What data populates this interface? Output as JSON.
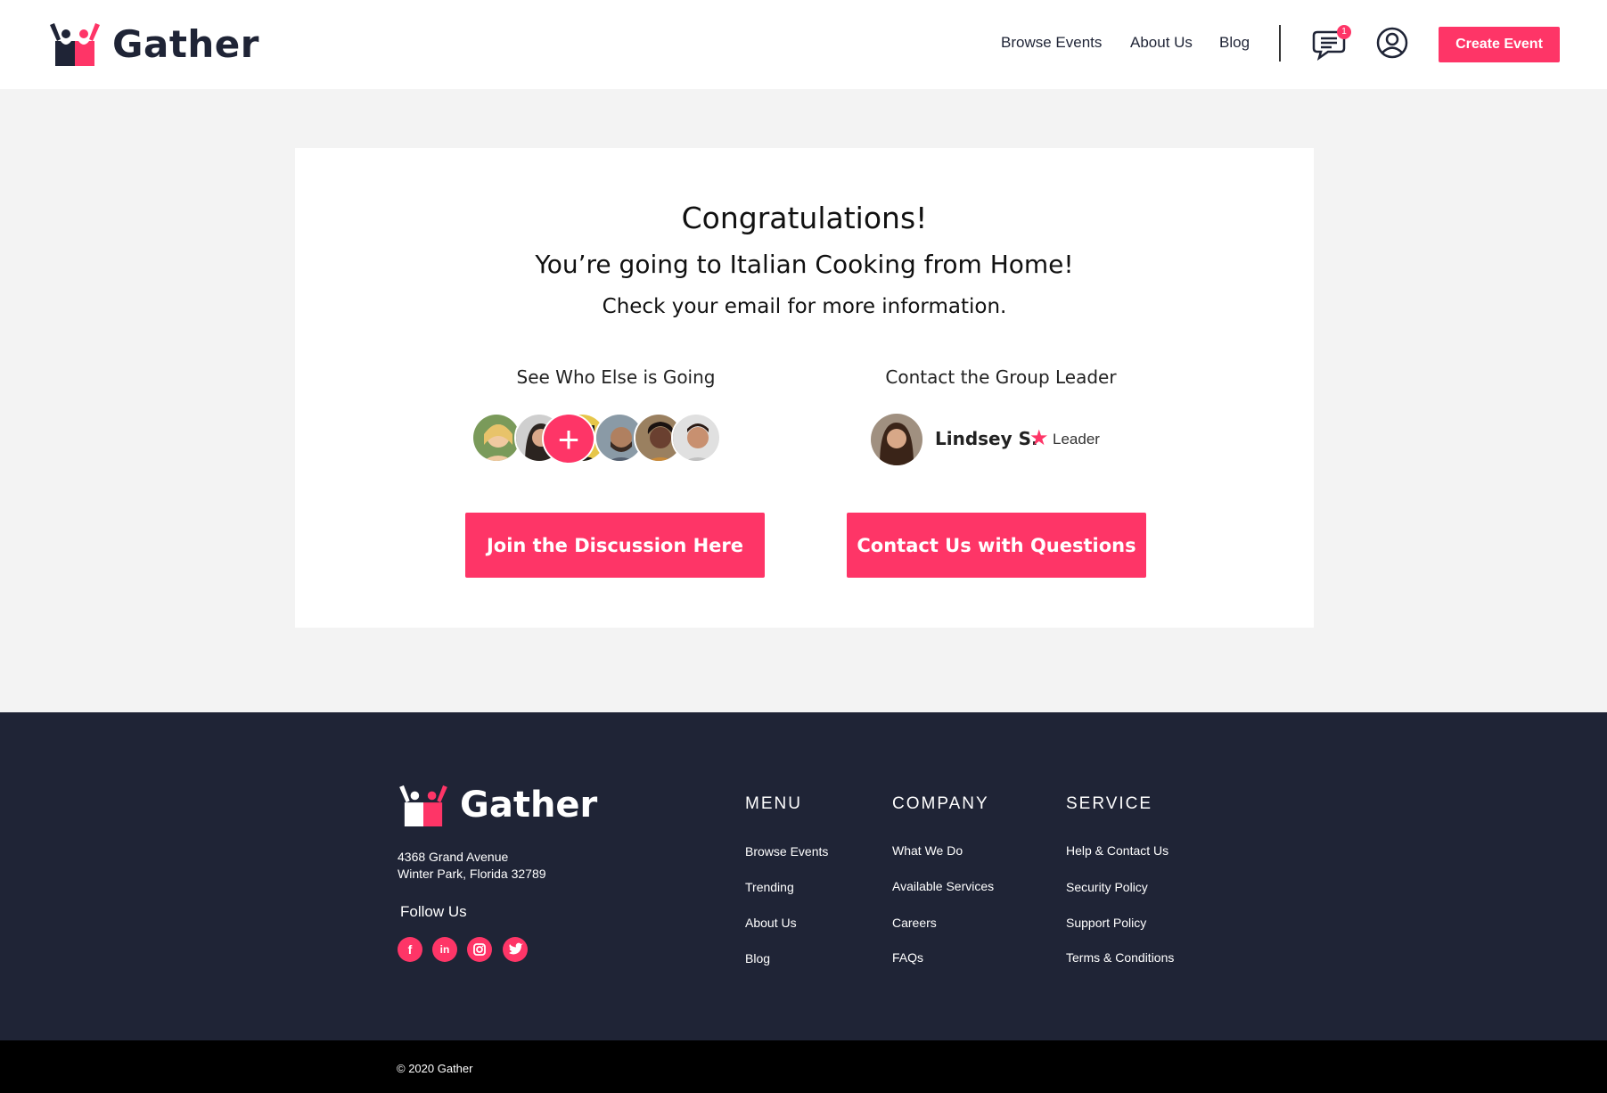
{
  "brand": {
    "name": "Gather",
    "accent": "#fe3567",
    "dark": "#1f2436"
  },
  "nav": {
    "browse_events": "Browse Events",
    "about_us": "About Us",
    "blog": "Blog",
    "notification_count": "1",
    "create_event": "Create Event"
  },
  "confirmation": {
    "title": "Congratulations!",
    "subtitle": "You’re going to Italian Cooking from Home!",
    "info": "Check your email for more information."
  },
  "attendees": {
    "heading": "See Who Else is Going",
    "avatar_colors": [
      "#d7b27a",
      "#4a3a33",
      "#e6c64a",
      "#6a7a86",
      "#5a3a2a",
      "#b98a6a"
    ],
    "plus": "+"
  },
  "leader": {
    "heading": "Contact the Group Leader",
    "name": "Lindsey S.",
    "role": "Leader"
  },
  "actions": {
    "join_discussion": "Join the Discussion Here",
    "contact_questions": "Contact Us with Questions"
  },
  "footer": {
    "address_line1": "4368 Grand Avenue",
    "address_line2": "Winter Park, Florida 32789",
    "follow_us": "Follow Us",
    "social": [
      "facebook-icon",
      "linkedin-icon",
      "instagram-icon",
      "twitter-icon"
    ],
    "menu": {
      "heading": "MENU",
      "items": [
        "Browse Events",
        "Trending",
        "About Us",
        "Blog"
      ]
    },
    "company": {
      "heading": "COMPANY",
      "items": [
        "What We Do",
        "Available Services",
        "Careers",
        "FAQs"
      ]
    },
    "service": {
      "heading": "SERVICE",
      "items": [
        "Help & Contact Us",
        "Security Policy",
        "Support Policy",
        "Terms & Conditions"
      ]
    },
    "copyright": "© 2020 Gather"
  }
}
